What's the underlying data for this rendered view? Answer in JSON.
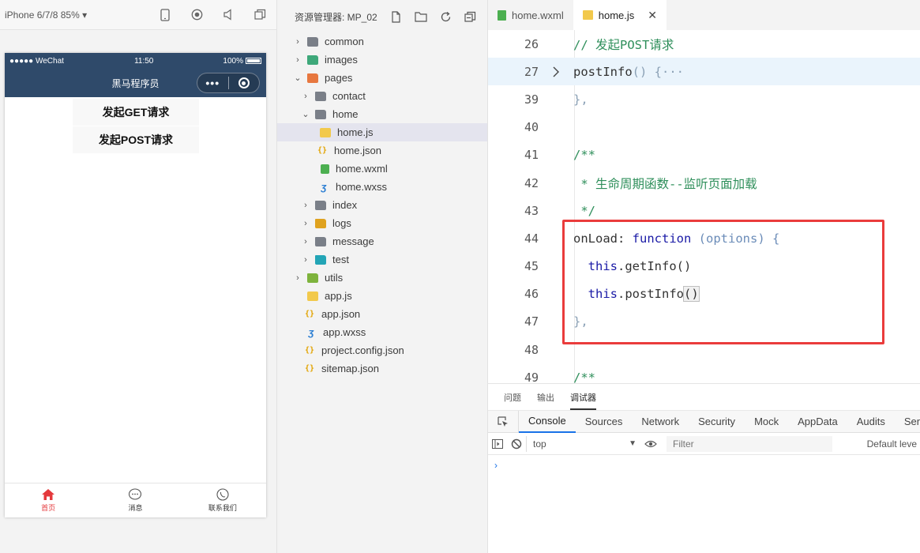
{
  "simulator": {
    "device_label": "iPhone 6/7/8 85% ▾",
    "status": {
      "carrier": "●●●●● WeChat",
      "time": "11:50",
      "battery": "100%"
    },
    "nav_title": "黑马程序员",
    "capsule_dots": "•••",
    "buttons": {
      "get": "发起GET请求",
      "post": "发起POST请求"
    },
    "tabbar": [
      {
        "label": "首页",
        "icon": "home-icon"
      },
      {
        "label": "消息",
        "icon": "message-icon"
      },
      {
        "label": "联系我们",
        "icon": "phone-icon"
      }
    ]
  },
  "explorer": {
    "title": "资源管理器: MP_02",
    "tree": {
      "common": "common",
      "images": "images",
      "pages": "pages",
      "contact": "contact",
      "home": "home",
      "home_js": "home.js",
      "home_json": "home.json",
      "home_wxml": "home.wxml",
      "home_wxss": "home.wxss",
      "index": "index",
      "logs": "logs",
      "message": "message",
      "test": "test",
      "utils": "utils",
      "app_js": "app.js",
      "app_json": "app.json",
      "app_wxss": "app.wxss",
      "project_config": "project.config.json",
      "sitemap": "sitemap.json"
    }
  },
  "editor": {
    "tabs": {
      "wxml": "home.wxml",
      "js": "home.js",
      "close": "✕"
    },
    "lines": [
      {
        "no": "26",
        "code": "// 发起POST请求"
      },
      {
        "no": "27",
        "code": "postInfo() {···"
      },
      {
        "no": "39",
        "code": "},"
      },
      {
        "no": "40",
        "code": ""
      },
      {
        "no": "41",
        "code": "/**"
      },
      {
        "no": "42",
        "code": " * 生命周期函数--监听页面加载"
      },
      {
        "no": "43",
        "code": " */"
      },
      {
        "no": "44",
        "code": "onLoad: function (options) {"
      },
      {
        "no": "45",
        "code": "  this.getInfo()"
      },
      {
        "no": "46",
        "code": "  this.postInfo()"
      },
      {
        "no": "47",
        "code": "},"
      },
      {
        "no": "48",
        "code": ""
      },
      {
        "no": "49",
        "code": "/**"
      }
    ],
    "tokens": {
      "l27_fn": "postInfo",
      "l27_rest": "() {···",
      "l44_key": "onLoad",
      "l44_colon": ": ",
      "l44_function": "function",
      "l44_params": " (options) {",
      "this": "this",
      "l45_call": ".getInfo()",
      "l46_call": ".postInfo",
      "l46_parens": "()"
    }
  },
  "panel": {
    "tabs": {
      "problems": "问题",
      "output": "输出",
      "debugger": "调试器"
    },
    "devtools_tabs": [
      "Console",
      "Sources",
      "Network",
      "Security",
      "Mock",
      "AppData",
      "Audits",
      "Senso"
    ],
    "context": "top",
    "filter_placeholder": "Filter",
    "levels": "Default leve",
    "prompt": "›"
  },
  "colors": {
    "nav_bg": "#2f4a6a",
    "active_tab": "#e4393c",
    "highlight_border": "#ea3c3c"
  }
}
